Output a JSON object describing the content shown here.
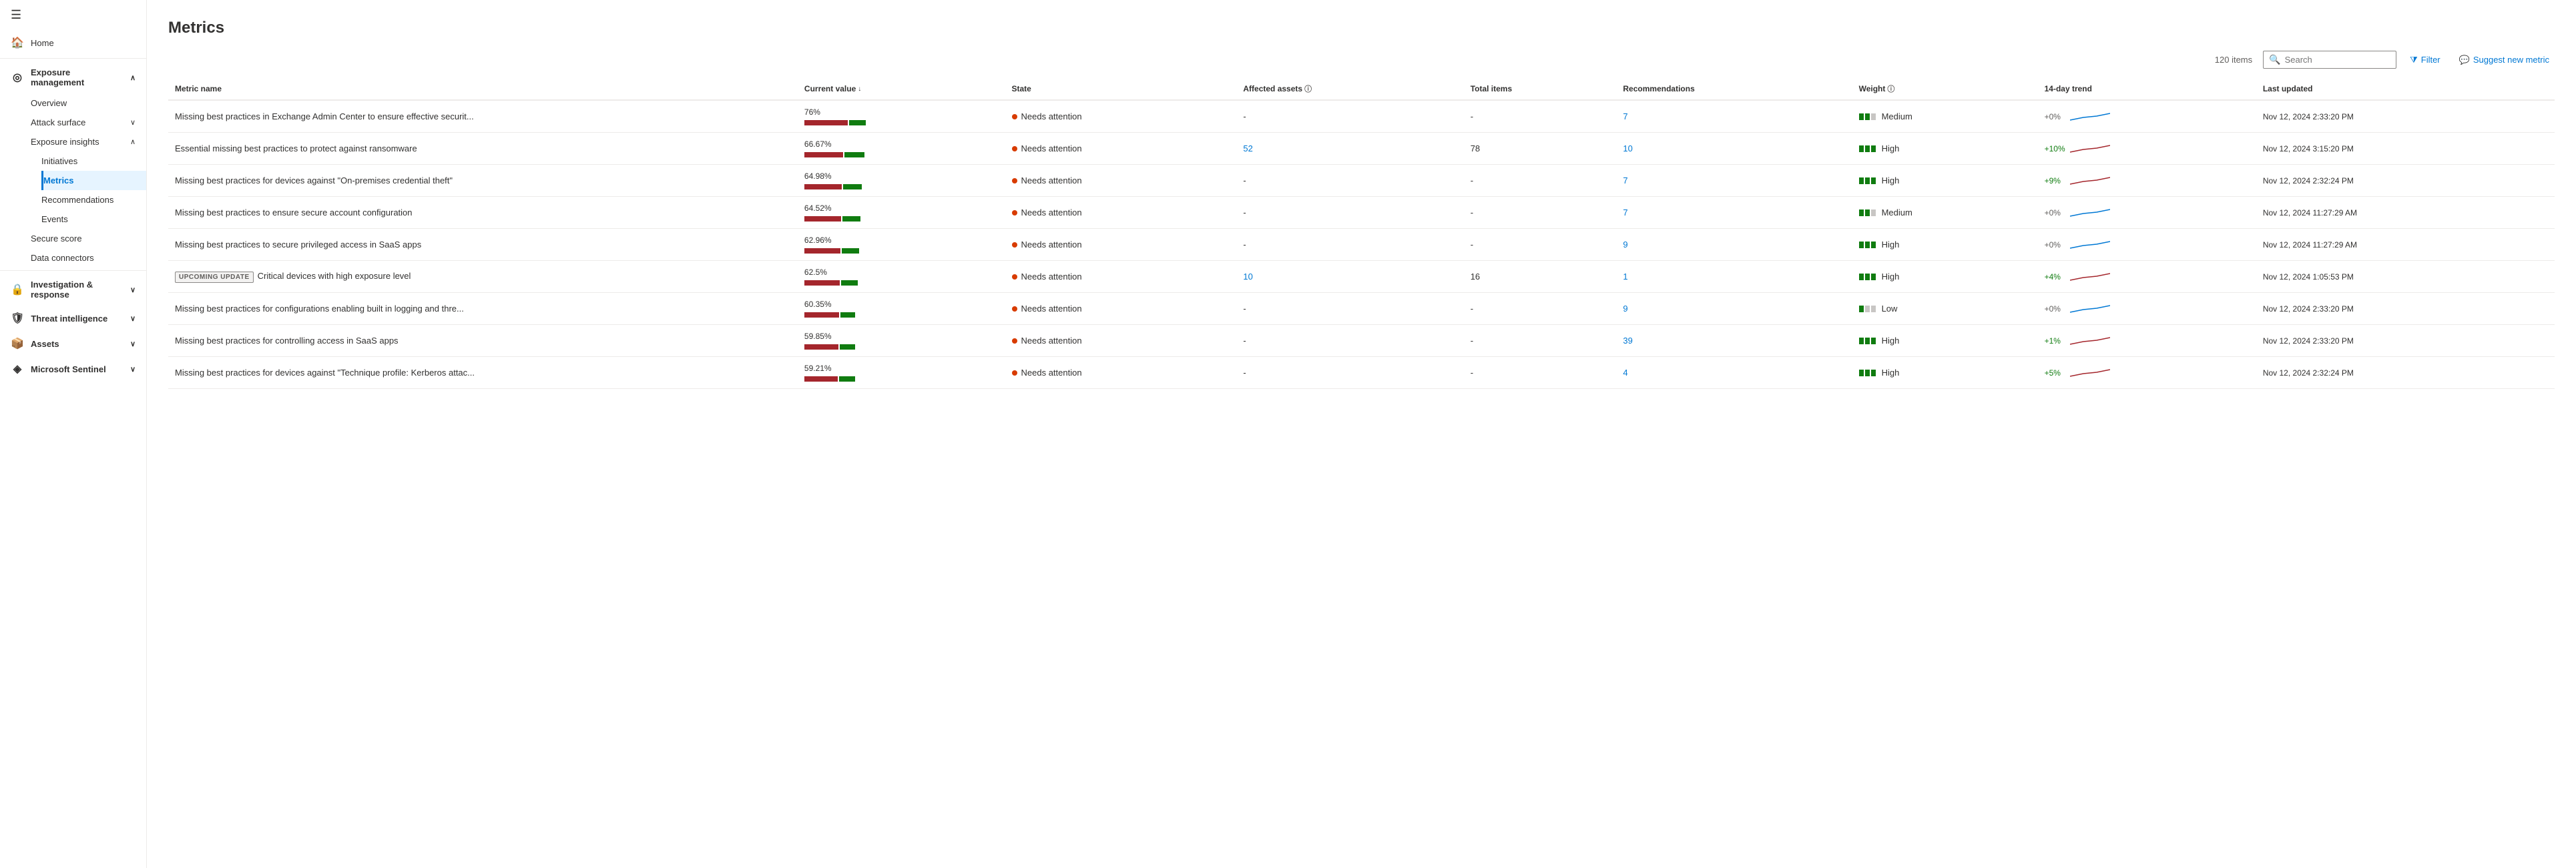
{
  "sidebar": {
    "hamburger": "☰",
    "items": [
      {
        "id": "home",
        "label": "Home",
        "icon": "🏠",
        "indent": 0,
        "expandable": false
      },
      {
        "id": "exposure-management",
        "label": "Exposure management",
        "icon": "◎",
        "indent": 0,
        "expandable": true,
        "expanded": true
      },
      {
        "id": "overview",
        "label": "Overview",
        "icon": "",
        "indent": 1,
        "expandable": false
      },
      {
        "id": "attack-surface",
        "label": "Attack surface",
        "icon": "",
        "indent": 1,
        "expandable": true
      },
      {
        "id": "exposure-insights",
        "label": "Exposure insights",
        "icon": "",
        "indent": 1,
        "expandable": true,
        "expanded": true
      },
      {
        "id": "initiatives",
        "label": "Initiatives",
        "icon": "",
        "indent": 2,
        "expandable": false
      },
      {
        "id": "metrics",
        "label": "Metrics",
        "icon": "",
        "indent": 2,
        "expandable": false,
        "active": true
      },
      {
        "id": "recommendations",
        "label": "Recommendations",
        "icon": "",
        "indent": 2,
        "expandable": false
      },
      {
        "id": "events",
        "label": "Events",
        "icon": "",
        "indent": 2,
        "expandable": false
      },
      {
        "id": "secure-score",
        "label": "Secure score",
        "icon": "",
        "indent": 1,
        "expandable": false
      },
      {
        "id": "data-connectors",
        "label": "Data connectors",
        "icon": "",
        "indent": 1,
        "expandable": false
      },
      {
        "id": "investigation-response",
        "label": "Investigation & response",
        "icon": "🔒",
        "indent": 0,
        "expandable": true
      },
      {
        "id": "threat-intelligence",
        "label": "Threat intelligence",
        "icon": "🛡",
        "indent": 0,
        "expandable": true
      },
      {
        "id": "assets",
        "label": "Assets",
        "icon": "📦",
        "indent": 0,
        "expandable": true
      },
      {
        "id": "microsoft-sentinel",
        "label": "Microsoft Sentinel",
        "icon": "◈",
        "indent": 0,
        "expandable": true
      }
    ]
  },
  "main": {
    "title": "Metrics",
    "item_count": "120 items",
    "search_placeholder": "Search",
    "filter_label": "Filter",
    "suggest_label": "Suggest new metric",
    "table": {
      "columns": [
        {
          "id": "metric_name",
          "label": "Metric name"
        },
        {
          "id": "current_value",
          "label": "Current value",
          "sort": "desc"
        },
        {
          "id": "state",
          "label": "State"
        },
        {
          "id": "affected_assets",
          "label": "Affected assets",
          "info": true
        },
        {
          "id": "total_items",
          "label": "Total items"
        },
        {
          "id": "recommendations",
          "label": "Recommendations"
        },
        {
          "id": "weight",
          "label": "Weight",
          "info": true
        },
        {
          "id": "trend",
          "label": "14-day trend"
        },
        {
          "id": "last_updated",
          "label": "Last updated"
        }
      ],
      "rows": [
        {
          "name": "Missing best practices in Exchange Admin Center to ensure effective securit...",
          "badge": "",
          "value": "76%",
          "red_pct": 65,
          "green_pct": 25,
          "state": "Needs attention",
          "affected_assets": "-",
          "total_items": "-",
          "recommendations": "7",
          "weight": "Medium",
          "weight_level": 2,
          "trend_val": "+0%",
          "trend_type": "zero",
          "trend_color": "blue",
          "last_updated": "Nov 12, 2024 2:33:20 PM"
        },
        {
          "name": "Essential missing best practices to protect against ransomware",
          "badge": "",
          "value": "66.67%",
          "red_pct": 58,
          "green_pct": 30,
          "state": "Needs attention",
          "affected_assets": "52",
          "affected_assets_link": true,
          "total_items": "78",
          "recommendations": "10",
          "weight": "High",
          "weight_level": 3,
          "trend_val": "+10%",
          "trend_type": "positive",
          "trend_color": "red",
          "last_updated": "Nov 12, 2024 3:15:20 PM"
        },
        {
          "name": "Missing best practices for devices against \"On-premises credential theft\"",
          "badge": "",
          "value": "64.98%",
          "red_pct": 56,
          "green_pct": 28,
          "state": "Needs attention",
          "affected_assets": "-",
          "total_items": "-",
          "recommendations": "7",
          "weight": "High",
          "weight_level": 3,
          "trend_val": "+9%",
          "trend_type": "positive",
          "trend_color": "red",
          "last_updated": "Nov 12, 2024 2:32:24 PM"
        },
        {
          "name": "Missing best practices to ensure secure account configuration",
          "badge": "",
          "value": "64.52%",
          "red_pct": 55,
          "green_pct": 27,
          "state": "Needs attention",
          "affected_assets": "-",
          "total_items": "-",
          "recommendations": "7",
          "weight": "Medium",
          "weight_level": 2,
          "trend_val": "+0%",
          "trend_type": "zero",
          "trend_color": "blue",
          "last_updated": "Nov 12, 2024 11:27:29 AM"
        },
        {
          "name": "Missing best practices to secure privileged access in SaaS apps",
          "badge": "",
          "value": "62.96%",
          "red_pct": 54,
          "green_pct": 26,
          "state": "Needs attention",
          "affected_assets": "-",
          "total_items": "-",
          "recommendations": "9",
          "weight": "High",
          "weight_level": 3,
          "trend_val": "+0%",
          "trend_type": "zero",
          "trend_color": "blue",
          "last_updated": "Nov 12, 2024 11:27:29 AM"
        },
        {
          "name": "Critical devices with high exposure level",
          "badge": "UPCOMING UPDATE",
          "value": "62.5%",
          "red_pct": 53,
          "green_pct": 25,
          "state": "Needs attention",
          "affected_assets": "10",
          "affected_assets_link": true,
          "total_items": "16",
          "recommendations": "1",
          "weight": "High",
          "weight_level": 3,
          "trend_val": "+4%",
          "trend_type": "positive",
          "trend_color": "red",
          "last_updated": "Nov 12, 2024 1:05:53 PM"
        },
        {
          "name": "Missing best practices for configurations enabling built in logging and thre...",
          "badge": "",
          "value": "60.35%",
          "red_pct": 52,
          "green_pct": 22,
          "state": "Needs attention",
          "affected_assets": "-",
          "total_items": "-",
          "recommendations": "9",
          "weight": "Low",
          "weight_level": 1,
          "trend_val": "+0%",
          "trend_type": "zero",
          "trend_color": "blue",
          "last_updated": "Nov 12, 2024 2:33:20 PM"
        },
        {
          "name": "Missing best practices for controlling access in SaaS apps",
          "badge": "",
          "value": "59.85%",
          "red_pct": 51,
          "green_pct": 23,
          "state": "Needs attention",
          "affected_assets": "-",
          "total_items": "-",
          "recommendations": "39",
          "weight": "High",
          "weight_level": 3,
          "trend_val": "+1%",
          "trend_type": "positive",
          "trend_color": "red",
          "last_updated": "Nov 12, 2024 2:33:20 PM"
        },
        {
          "name": "Missing best practices for devices against \"Technique profile: Kerberos attac...",
          "badge": "",
          "value": "59.21%",
          "red_pct": 50,
          "green_pct": 24,
          "state": "Needs attention",
          "affected_assets": "-",
          "total_items": "-",
          "recommendations": "4",
          "weight": "High",
          "weight_level": 3,
          "trend_val": "+5%",
          "trend_type": "positive",
          "trend_color": "red",
          "last_updated": "Nov 12, 2024 2:32:24 PM"
        }
      ]
    }
  }
}
